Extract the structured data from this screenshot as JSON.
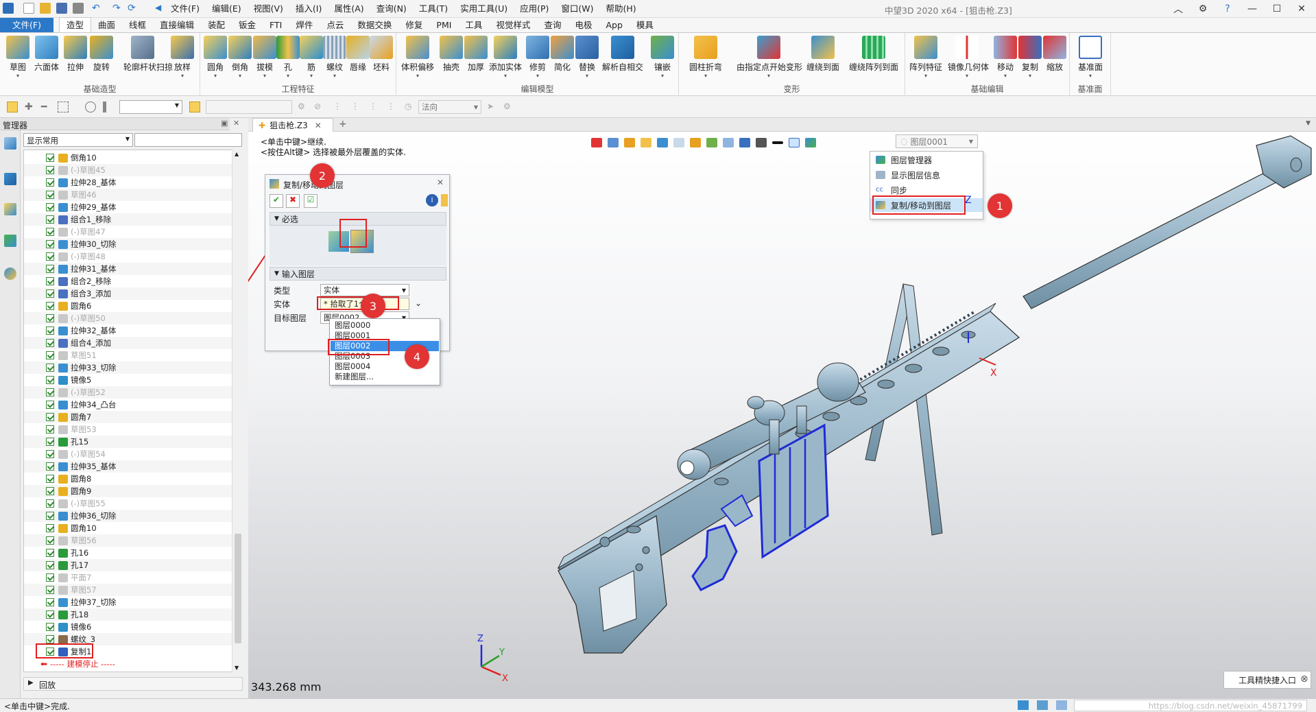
{
  "titlebar": {
    "app_title": "中望3D 2020 x64 - [狙击枪.Z3]",
    "menus": [
      "文件(F)",
      "编辑(E)",
      "视图(V)",
      "插入(I)",
      "属性(A)",
      "查询(N)",
      "工具(T)",
      "实用工具(U)",
      "应用(P)",
      "窗口(W)",
      "帮助(H)"
    ]
  },
  "ribbon_tabs": [
    "文件(F)",
    "造型",
    "曲面",
    "线框",
    "直接编辑",
    "装配",
    "钣金",
    "FTI",
    "焊件",
    "点云",
    "数据交换",
    "修复",
    "PMI",
    "工具",
    "视觉样式",
    "查询",
    "电极",
    "App",
    "模具"
  ],
  "ribbon_groups": [
    {
      "label": "基础造型",
      "buttons": [
        "草图",
        "六面体",
        "拉伸",
        "旋转",
        "轮廓杆状扫掠",
        "放样"
      ]
    },
    {
      "label": "工程特征",
      "buttons": [
        "圆角",
        "倒角",
        "拔模",
        "孔",
        "筋",
        "螺纹",
        "唇缘",
        "坯料"
      ]
    },
    {
      "label": "编辑模型",
      "buttons": [
        "体积偏移",
        "抽壳",
        "加厚",
        "添加实体",
        "修剪",
        "简化",
        "替换",
        "解析自相交",
        "镶嵌"
      ]
    },
    {
      "label": "变形",
      "buttons": [
        "圆柱折弯",
        "由指定点开始变形",
        "缠绕到面",
        "缠绕阵列到面"
      ]
    },
    {
      "label": "基础编辑",
      "buttons": [
        "阵列特征",
        "镜像几何体",
        "移动",
        "复制",
        "缩放"
      ]
    },
    {
      "label": "基准面",
      "buttons": [
        "基准面"
      ]
    }
  ],
  "toolbar2": {
    "filter_value": "",
    "direction_placeholder": "法向"
  },
  "manager": {
    "title": "管理器",
    "filter": "显示常用",
    "search_value": ""
  },
  "tree": [
    {
      "label": "倒角10",
      "gray": false,
      "icon": "#e8b020"
    },
    {
      "label": "(-)草图45",
      "gray": true,
      "icon": "#c8c8c8"
    },
    {
      "label": "拉伸28_基体",
      "gray": false,
      "icon": "#3a8fd0"
    },
    {
      "label": "草图46",
      "gray": true,
      "icon": "#c8c8c8"
    },
    {
      "label": "拉伸29_基体",
      "gray": false,
      "icon": "#3a8fd0"
    },
    {
      "label": "组合1_移除",
      "gray": false,
      "icon": "#4a70c0"
    },
    {
      "label": "(-)草图47",
      "gray": true,
      "icon": "#c8c8c8"
    },
    {
      "label": "拉伸30_切除",
      "gray": false,
      "icon": "#3a8fd0"
    },
    {
      "label": "(-)草图48",
      "gray": true,
      "icon": "#c8c8c8"
    },
    {
      "label": "拉伸31_基体",
      "gray": false,
      "icon": "#3a8fd0"
    },
    {
      "label": "组合2_移除",
      "gray": false,
      "icon": "#4a70c0"
    },
    {
      "label": "组合3_添加",
      "gray": false,
      "icon": "#4a70c0"
    },
    {
      "label": "圆角6",
      "gray": false,
      "icon": "#e8b020"
    },
    {
      "label": "(-)草图50",
      "gray": true,
      "icon": "#c8c8c8"
    },
    {
      "label": "拉伸32_基体",
      "gray": false,
      "icon": "#3a8fd0"
    },
    {
      "label": "组合4_添加",
      "gray": false,
      "icon": "#4a70c0"
    },
    {
      "label": "草图51",
      "gray": true,
      "icon": "#c8c8c8"
    },
    {
      "label": "拉伸33_切除",
      "gray": false,
      "icon": "#3a8fd0"
    },
    {
      "label": "镜像5",
      "gray": false,
      "icon": "#2f8fc8"
    },
    {
      "label": "(-)草图52",
      "gray": true,
      "icon": "#c8c8c8"
    },
    {
      "label": "拉伸34_凸台",
      "gray": false,
      "icon": "#3a8fd0"
    },
    {
      "label": "圆角7",
      "gray": false,
      "icon": "#e8b020"
    },
    {
      "label": "草图53",
      "gray": true,
      "icon": "#c8c8c8"
    },
    {
      "label": "孔15",
      "gray": false,
      "icon": "#2a9a3a"
    },
    {
      "label": "(-)草图54",
      "gray": true,
      "icon": "#c8c8c8"
    },
    {
      "label": "拉伸35_基体",
      "gray": false,
      "icon": "#3a8fd0"
    },
    {
      "label": "圆角8",
      "gray": false,
      "icon": "#e8b020"
    },
    {
      "label": "圆角9",
      "gray": false,
      "icon": "#e8b020"
    },
    {
      "label": "(-)草图55",
      "gray": true,
      "icon": "#c8c8c8"
    },
    {
      "label": "拉伸36_切除",
      "gray": false,
      "icon": "#3a8fd0"
    },
    {
      "label": "圆角10",
      "gray": false,
      "icon": "#e8b020"
    },
    {
      "label": "草图56",
      "gray": true,
      "icon": "#c8c8c8"
    },
    {
      "label": "孔16",
      "gray": false,
      "icon": "#2a9a3a"
    },
    {
      "label": "孔17",
      "gray": false,
      "icon": "#2a9a3a"
    },
    {
      "label": "平面7",
      "gray": true,
      "icon": "#c8c8c8"
    },
    {
      "label": "草图57",
      "gray": true,
      "icon": "#c8c8c8"
    },
    {
      "label": "拉伸37_切除",
      "gray": false,
      "icon": "#3a8fd0"
    },
    {
      "label": "孔18",
      "gray": false,
      "icon": "#2a9a3a"
    },
    {
      "label": "镜像6",
      "gray": false,
      "icon": "#2f8fc8"
    },
    {
      "label": "螺纹_3",
      "gray": false,
      "icon": "#8a6a4a"
    },
    {
      "label": "复制1",
      "gray": false,
      "icon": "#3060c0"
    }
  ],
  "tree_stop": "----- 建模停止 -----",
  "playback": "回放",
  "doc_tab": "狙击枪.Z3",
  "hints": [
    "<单击中键>继续.",
    "<按住Alt键> 选择被最外层覆盖的实体."
  ],
  "layer_box": "图层0001",
  "layer_menu": [
    "图层管理器",
    "显示图层信息",
    "同步",
    "复制/移动到图层"
  ],
  "dialog": {
    "title": "复制/移动到图层",
    "section_required": "必选",
    "section_input": "输入图层",
    "type_label": "类型",
    "type_value": "实体",
    "entity_label": "实体",
    "entity_value": "* 拾取了1个 *",
    "target_label": "目标图层",
    "target_value": "图层0002"
  },
  "layer_options": [
    "图层0000",
    "图层0001",
    "图层0002",
    "图层0003",
    "图层0004",
    "新建图层..."
  ],
  "markers": [
    "1",
    "2",
    "3",
    "4"
  ],
  "measure": "343.268 mm",
  "quick_tool": "工具精快捷入口",
  "status": "<单击中键>完成.",
  "watermark": "https://blog.csdn.net/weixin_45871799",
  "axis": {
    "x": "X",
    "y": "Y",
    "z": "Z"
  },
  "colors": {
    "accent": "#2b78c8",
    "model": "#9ab7c9",
    "highlight": "#1f2bd6",
    "marker": "#e23434"
  }
}
